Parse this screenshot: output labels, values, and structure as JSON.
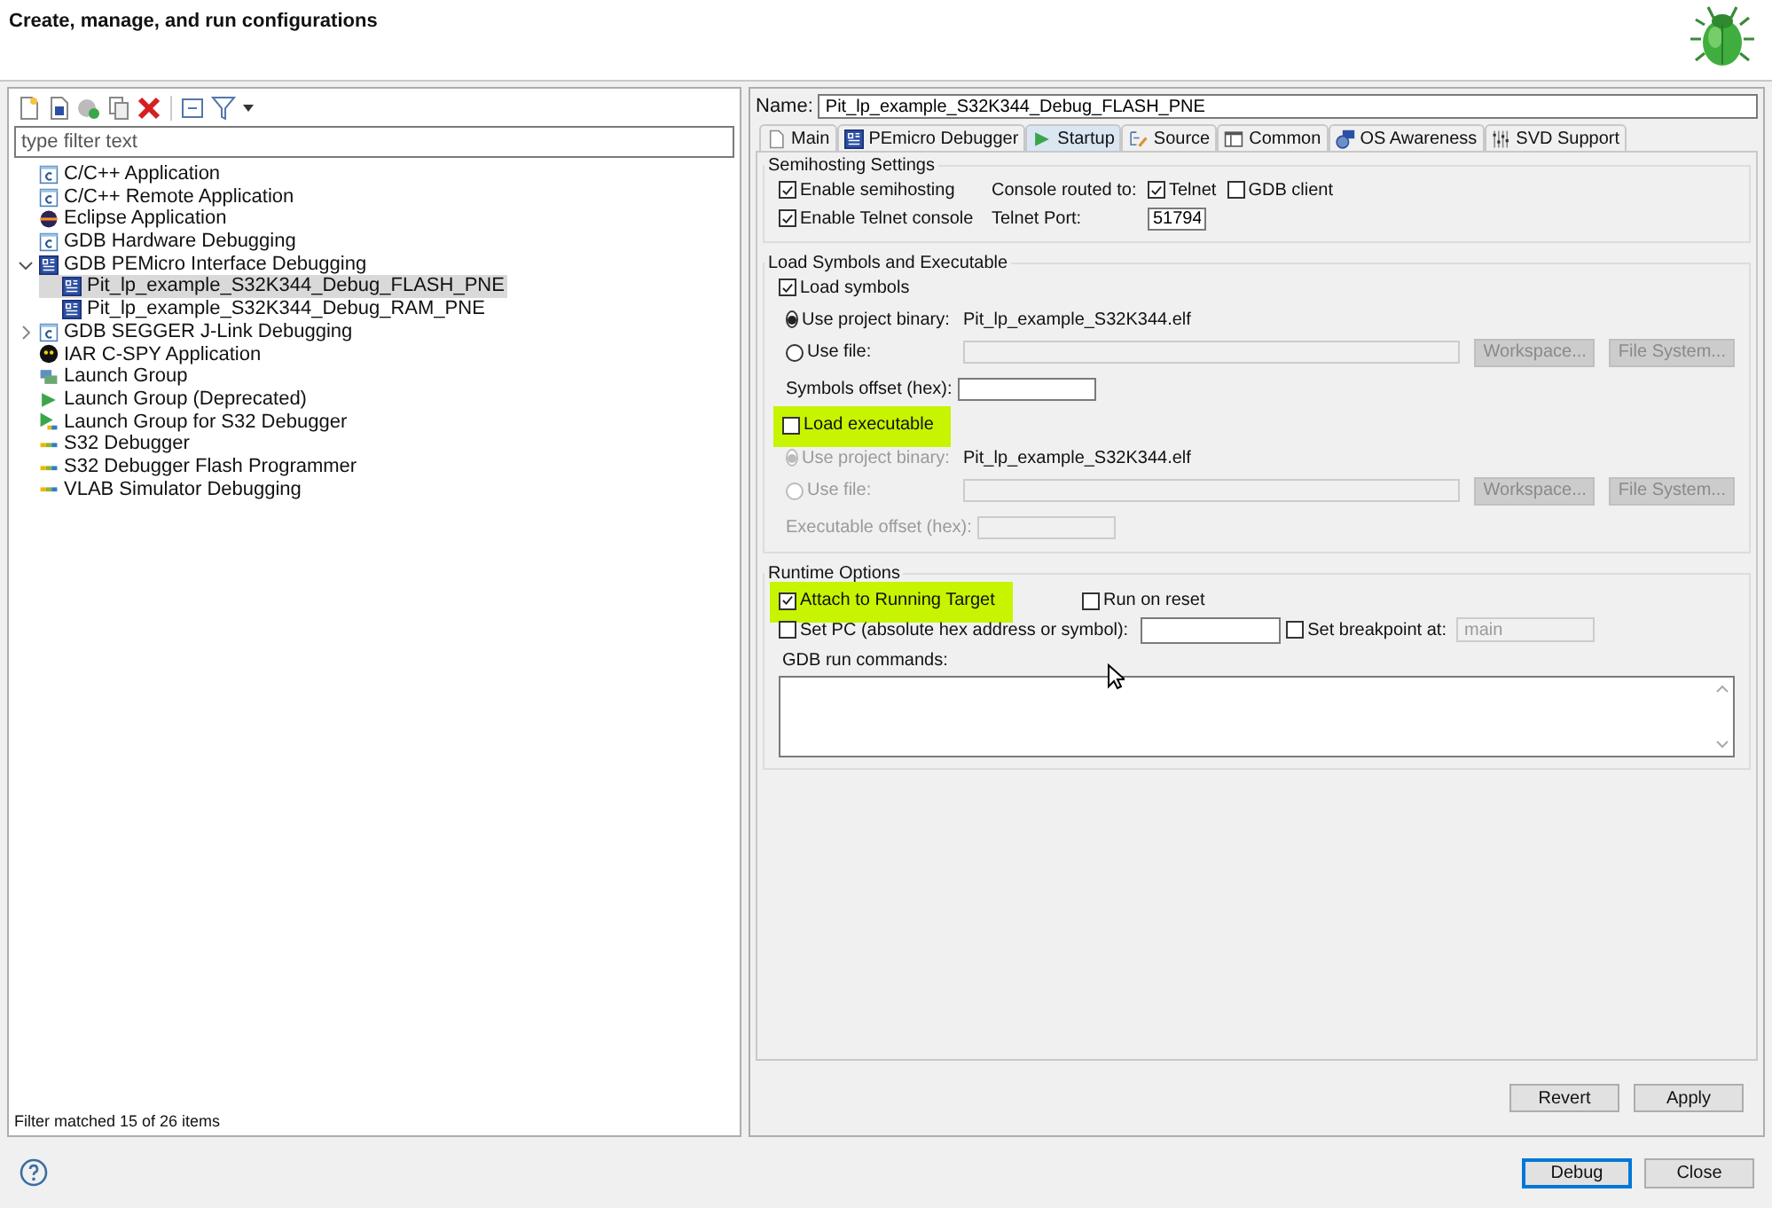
{
  "window": {
    "title": "Create, manage, and run configurations"
  },
  "filter": {
    "placeholder": "type filter text"
  },
  "tree": [
    {
      "label": "C/C++ Application",
      "kind": "cfile",
      "selected": false
    },
    {
      "label": "C/C++ Remote Application",
      "kind": "cfile",
      "selected": false
    },
    {
      "label": "Eclipse Application",
      "kind": "eclipse",
      "selected": false
    },
    {
      "label": "GDB Hardware Debugging",
      "kind": "cfile",
      "selected": false
    },
    {
      "label": "GDB PEMicro Interface Debugging",
      "kind": "pemicro",
      "selected": false,
      "expanded": true,
      "children": [
        {
          "label": "Pit_lp_example_S32K344_Debug_FLASH_PNE",
          "kind": "pemicro",
          "selected": true
        },
        {
          "label": "Pit_lp_example_S32K344_Debug_RAM_PNE",
          "kind": "pemicro",
          "selected": false
        }
      ]
    },
    {
      "label": "GDB SEGGER J-Link Debugging",
      "kind": "cfile",
      "selected": false,
      "expanded": false
    },
    {
      "label": "IAR C-SPY Application",
      "kind": "iar",
      "selected": false
    },
    {
      "label": "Launch Group",
      "kind": "group",
      "selected": false
    },
    {
      "label": "Launch Group (Deprecated)",
      "kind": "play",
      "selected": false
    },
    {
      "label": "Launch Group for S32 Debugger",
      "kind": "playnxp",
      "selected": false
    },
    {
      "label": "S32 Debugger",
      "kind": "nxp",
      "selected": false
    },
    {
      "label": "S32 Debugger Flash Programmer",
      "kind": "nxp",
      "selected": false
    },
    {
      "label": "VLAB Simulator Debugging",
      "kind": "nxp",
      "selected": false
    }
  ],
  "filter_status": "Filter matched 15 of 26 items",
  "name": {
    "label": "Name:",
    "value": "Pit_lp_example_S32K344_Debug_FLASH_PNE"
  },
  "tabs": [
    {
      "label": "Main",
      "kind": "page",
      "selected": false
    },
    {
      "label": "PEmicro Debugger",
      "kind": "pemicro",
      "selected": false
    },
    {
      "label": "Startup",
      "kind": "play",
      "selected": true
    },
    {
      "label": "Source",
      "kind": "source",
      "selected": false
    },
    {
      "label": "Common",
      "kind": "common",
      "selected": false
    },
    {
      "label": "OS Awareness",
      "kind": "os",
      "selected": false
    },
    {
      "label": "SVD Support",
      "kind": "svd",
      "selected": false
    }
  ],
  "semihosting": {
    "title": "Semihosting Settings",
    "enable_semihosting": {
      "label": "Enable semihosting",
      "checked": true
    },
    "enable_telnet": {
      "label": "Enable Telnet console",
      "checked": true
    },
    "console_label": "Console routed to:",
    "telnet": {
      "label": "Telnet",
      "checked": true
    },
    "gdb_client": {
      "label": "GDB client",
      "checked": false
    },
    "port_label": "Telnet Port:",
    "port_value": "51794"
  },
  "load": {
    "title": "Load Symbols and Executable",
    "load_symbols": {
      "label": "Load symbols",
      "checked": true
    },
    "symbols": {
      "disabled": false,
      "project": {
        "label": "Use project binary:",
        "selected": true,
        "value": "Pit_lp_example_S32K344.elf"
      },
      "file": {
        "label": "Use file:",
        "selected": false
      },
      "workspace": "Workspace...",
      "file_system": "File System...",
      "offset_label": "Symbols offset (hex):"
    },
    "load_executable": {
      "label": "Load executable",
      "checked": false,
      "highlighted": true
    },
    "executable": {
      "disabled": true,
      "project": {
        "label": "Use project binary:",
        "selected": true,
        "value": "Pit_lp_example_S32K344.elf"
      },
      "file": {
        "label": "Use file:",
        "selected": false
      },
      "workspace": "Workspace...",
      "file_system": "File System...",
      "offset_label": "Executable offset (hex):"
    }
  },
  "runtime": {
    "title": "Runtime Options",
    "attach": {
      "label": "Attach to Running Target",
      "checked": true,
      "highlighted": true
    },
    "run_on_reset": {
      "label": "Run on reset",
      "checked": false
    },
    "set_pc": {
      "label": "Set PC (absolute hex address or symbol):",
      "checked": false
    },
    "set_breakpoint": {
      "label": "Set breakpoint at:",
      "checked": false
    },
    "breakpoint_value": "main",
    "commands_label": "GDB run commands:"
  },
  "actions": [
    "Revert",
    "Apply"
  ],
  "dialog_buttons": [
    {
      "label": "Debug",
      "default": true
    },
    {
      "label": "Close",
      "default": false
    }
  ]
}
